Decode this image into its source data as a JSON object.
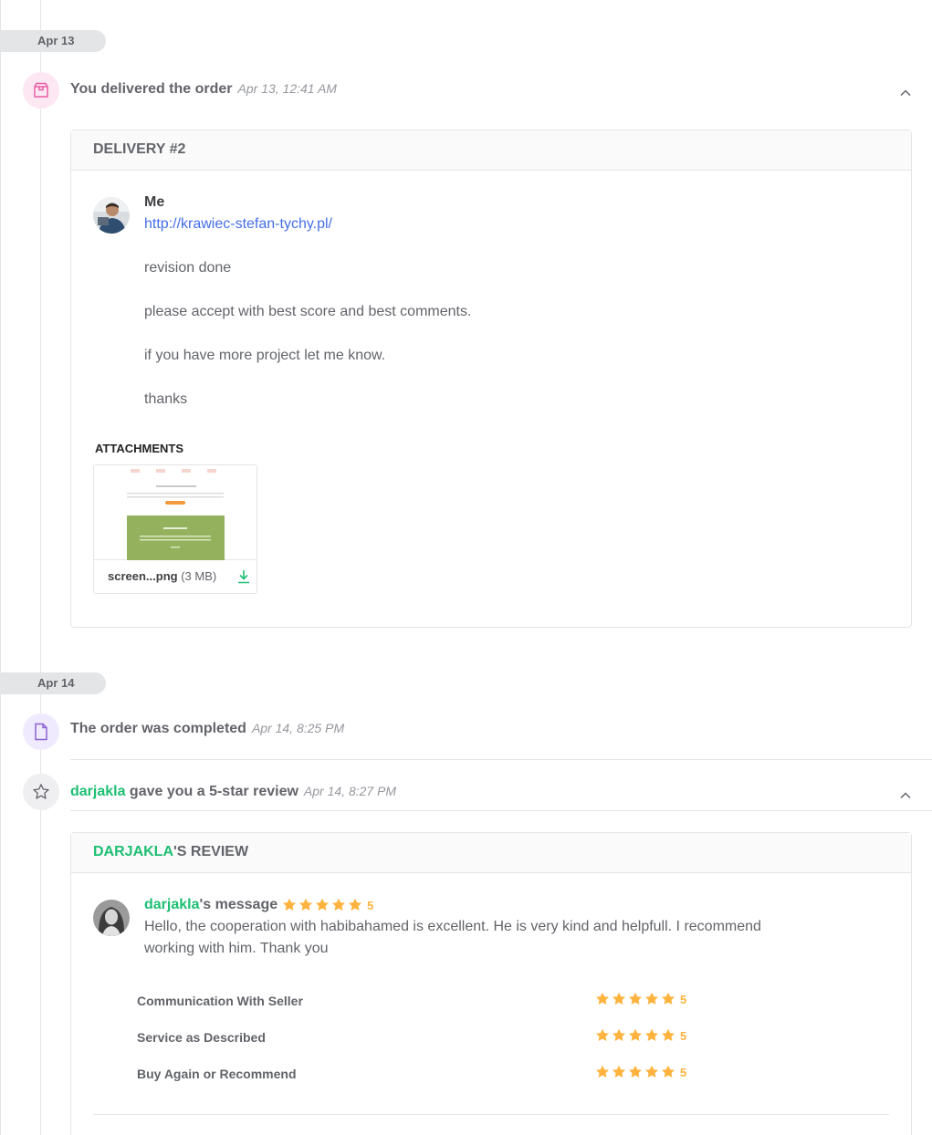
{
  "dates": {
    "apr13": "Apr 13",
    "apr14": "Apr 14"
  },
  "events": {
    "delivered": {
      "title": "You delivered the order",
      "time": "Apr 13, 12:41 AM",
      "icon": "package-icon"
    },
    "completed": {
      "title": "The order was completed",
      "time": "Apr 14, 8:25 PM",
      "icon": "document-icon"
    },
    "review": {
      "user": "darjakla",
      "title_suffix": " gave you a 5-star review",
      "time": "Apr 14, 8:27 PM",
      "icon": "star-outline-icon"
    }
  },
  "delivery": {
    "header": "DELIVERY #2",
    "sender": "Me",
    "link": "http://krawiec-stefan-tychy.pl/",
    "lines": [
      "revision done",
      "please accept with best score and best comments.",
      "if you have more project let me know.",
      "thanks"
    ],
    "attachments_label": "ATTACHMENTS",
    "attachment": {
      "name": "screen...png",
      "size": "(3 MB)"
    }
  },
  "review": {
    "header_user": "DARJAKLA",
    "header_suffix": "'S REVIEW",
    "message_user": "darjakla",
    "message_suffix": "'s message",
    "overall": "5",
    "text_line1": "Hello, the cooperation with habibahamed is excellent. He is very kind and helpfull. I recommend",
    "text_line2": "working with him. Thank you",
    "ratings": [
      {
        "label": "Communication With Seller",
        "value": "5"
      },
      {
        "label": "Service as Described",
        "value": "5"
      },
      {
        "label": "Buy Again or Recommend",
        "value": "5"
      }
    ]
  },
  "colors": {
    "green": "#1dbf73",
    "star": "#ffb33e",
    "link": "#446ee7",
    "pink_bg": "#fde7f3",
    "purple_bg": "#efeafd"
  }
}
